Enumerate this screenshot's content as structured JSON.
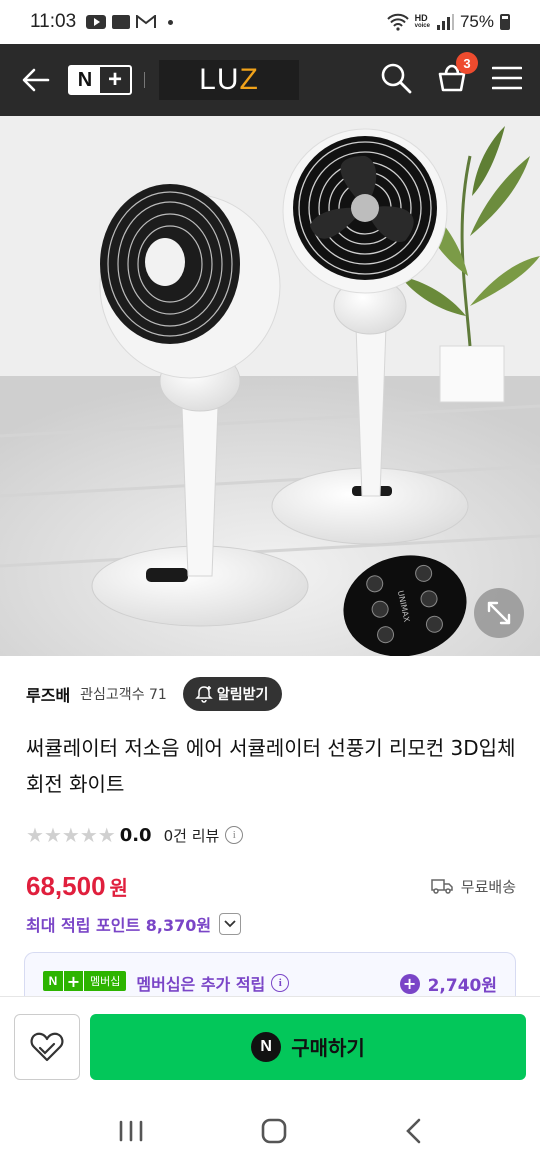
{
  "status_bar": {
    "time": "11:03",
    "battery": "75%",
    "hd_label": "HD",
    "voice_label": "voice"
  },
  "header": {
    "n_letter": "N",
    "plus_sign": "+",
    "brand_logo": "LUZ",
    "cart_count": "3"
  },
  "product_image": {
    "remote_brand": "UNIMAX"
  },
  "store": {
    "name": "루즈배",
    "fans": "관심고객수 71",
    "notify_label": "알림받기"
  },
  "product": {
    "title": "써큘레이터 저소음 에어 서큘레이터 선풍기 리모컨 3D입체회전 화이트",
    "rating": "0.0",
    "review_count": "0건 리뷰",
    "price": "68,500",
    "currency": "원",
    "shipping": "무료배송",
    "max_points": "최대 적립 포인트 8,370원"
  },
  "membership": {
    "n_letter": "N",
    "plus_sign": "+",
    "badge_label": "멤버십",
    "text": "멤버십은 추가 적립",
    "extra_points": "2,740원"
  },
  "buy_bar": {
    "n_letter": "N",
    "buy_label": "구매하기"
  },
  "colors": {
    "header_bg": "#2a2a2a",
    "price_red": "#e01f3d",
    "points_purple": "#7a45c7",
    "naver_green": "#03c75a",
    "cart_badge": "#ee4b2e"
  },
  "icons": [
    "back-arrow-icon",
    "search-icon",
    "cart-icon",
    "menu-icon",
    "expand-icon",
    "bell-plus-icon",
    "star-icon",
    "info-icon",
    "truck-icon",
    "chevron-down-icon",
    "heart-icon",
    "recents-icon",
    "home-icon",
    "back-nav-icon"
  ]
}
